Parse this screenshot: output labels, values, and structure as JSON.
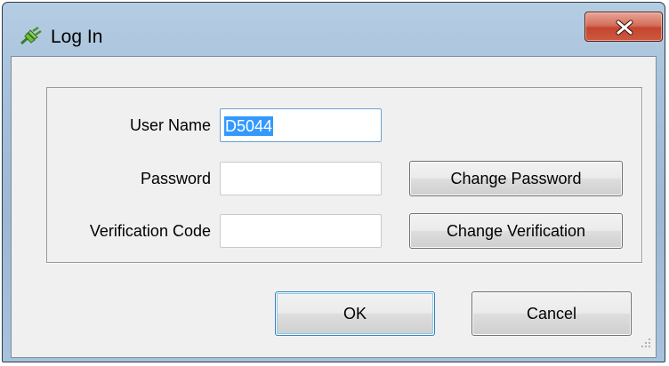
{
  "window": {
    "title": "Log In"
  },
  "form": {
    "username_label": "User Name",
    "username_value": "D5044",
    "password_label": "Password",
    "password_value": "",
    "verification_label": "Verification Code",
    "verification_value": ""
  },
  "buttons": {
    "change_password": "Change Password",
    "change_verification": "Change Verification",
    "ok": "OK",
    "cancel": "Cancel"
  },
  "icons": {
    "app": "plug-icon",
    "close": "close-icon",
    "grip": "resize-grip-icon"
  }
}
